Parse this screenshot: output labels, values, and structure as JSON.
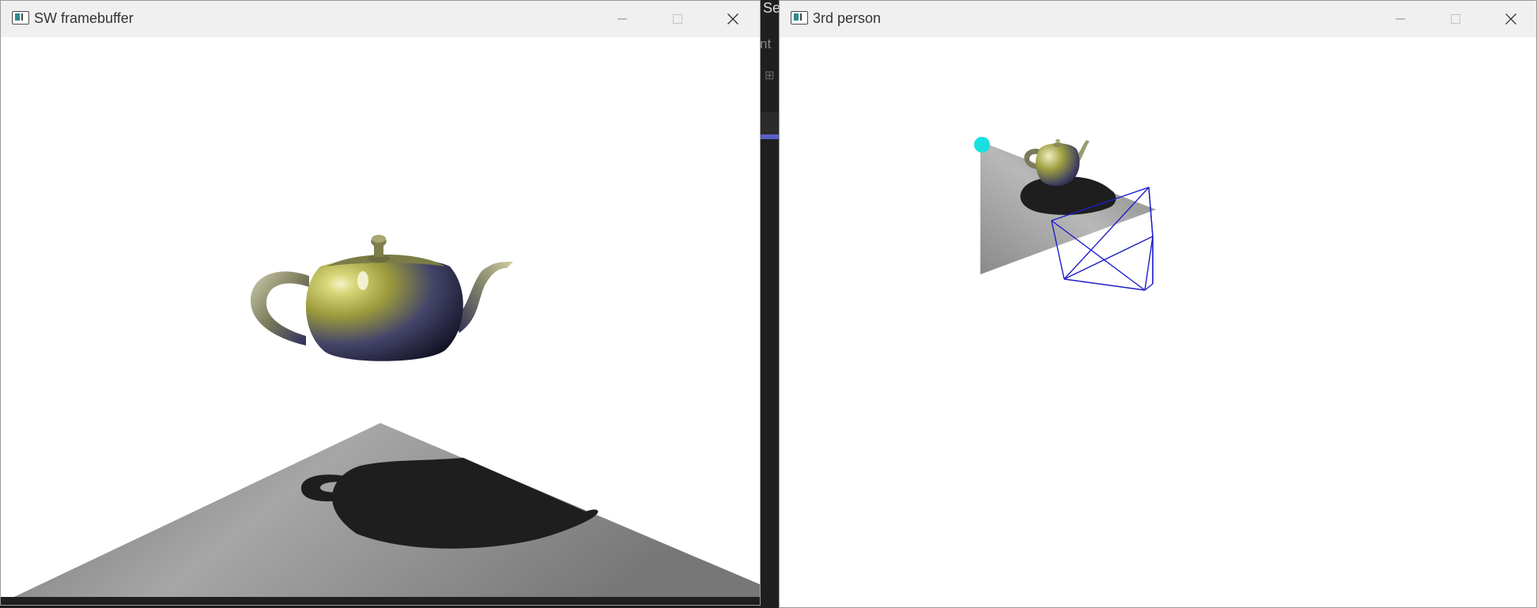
{
  "background_app": {
    "title_fragment": "Se",
    "line_fragment": "nt",
    "accent_color": "#5b5fc7"
  },
  "windows": [
    {
      "title": "SW framebuffer",
      "icon": "app-window-icon",
      "controls": [
        "minimize-icon",
        "maximize-icon",
        "close-icon"
      ]
    },
    {
      "title": "3rd person",
      "icon": "app-window-icon",
      "controls": [
        "minimize-icon",
        "maximize-icon",
        "close-icon"
      ]
    }
  ],
  "scene": {
    "teapot_color": "#9a9a3c",
    "plane_color": "#8a8a8a",
    "shadow_color": "#1e1e1e",
    "frustum_color": "#1e1ec8",
    "light_color": "#19e0e0"
  }
}
